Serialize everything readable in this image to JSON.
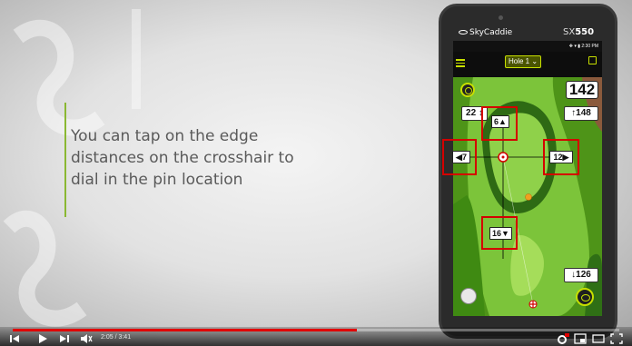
{
  "video": {
    "caption": "You can tap on the edge distances on the crosshair to dial in the pin location",
    "time_display": "2:05 / 3:41",
    "progress": 0.567
  },
  "device": {
    "brand": "SkyCaddie",
    "model_prefix": "SX",
    "model_number": "550",
    "clock": "2:30 PM"
  },
  "app": {
    "hole_label": "Hole 1",
    "main_distance": "142",
    "front_distance": "22",
    "pin_distance": "148",
    "back_distance": "126",
    "crosshair": {
      "top": "6",
      "left": "7",
      "right": "12",
      "bottom": "16"
    }
  },
  "colors": {
    "accent": "#c8e000",
    "highlight": "#d40000",
    "progress": "#e00000"
  },
  "icons": [
    "menu-icon",
    "edit-icon",
    "target-icon",
    "eye-icon",
    "play-icon",
    "next-icon",
    "volume-muted-icon",
    "settings-icon",
    "miniplayer-icon",
    "theater-icon",
    "fullscreen-icon"
  ]
}
